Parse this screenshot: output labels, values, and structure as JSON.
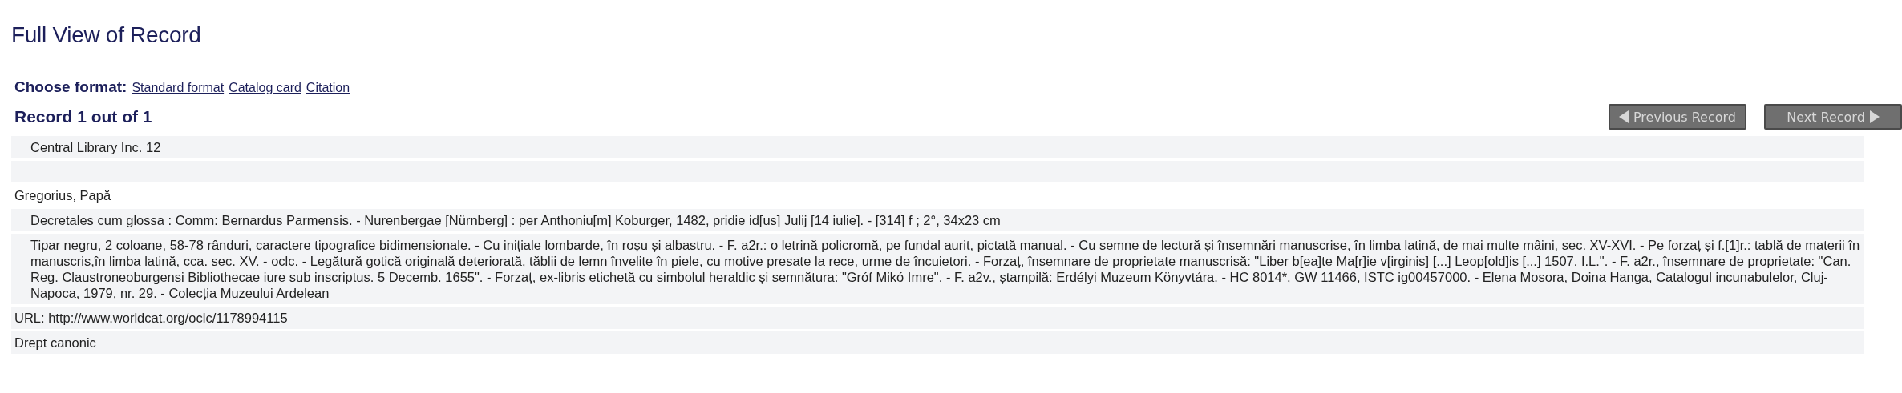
{
  "page_title": "Full View of Record",
  "format_chooser": {
    "label": "Choose format:",
    "links": [
      "Standard format",
      "Catalog card",
      "Citation"
    ]
  },
  "record_counter": "Record 1 out of 1",
  "nav_buttons": [
    {
      "label": "Previous Record",
      "kind": "previous"
    },
    {
      "label": "Next Record",
      "kind": "next"
    }
  ],
  "fields": [
    {
      "text": "Central Library Inc. 12",
      "shaded": true,
      "indented": true
    },
    {
      "shaded": true,
      "indented": false
    },
    {
      "text": "Gregorius, Papă",
      "shaded": false,
      "indented": false
    },
    {
      "text": "Decretales cum glossa : Comm: Bernardus Parmensis. - Nurenbergae [Nürnberg] : per Anthoniu[m] Koburger, 1482, pridie id[us] Julij [14 iulie]. - [314] f ; 2°, 34x23 cm",
      "shaded": true,
      "indented": true
    },
    {
      "text": "Tipar negru, 2 coloane, 58-78 rânduri, caractere tipografice bidimensionale. - Cu inițiale lombarde, în roșu și albastru. - F. a2r.: o letrină policromă, pe fundal aurit, pictată manual. - Cu semne de lectură și însemnări manuscrise, în limba latină, de mai multe mâini, sec. XV-XVI. - Pe forzaț și f.[1]r.: tablă de materii în manuscris,în limba latină, cca. sec. XV. - oclc. - Legătură gotică originală deteriorată, tăblii de lemn învelite în piele, cu motive presate la rece, urme de încuietori. - Forzaț, însemnare de proprietate manuscrisă: \"Liber b[ea]te Ma[r]ie v[irginis] [...] Leop[old]is [...] 1507. I.L.\". - F. a2r., însemnare de proprietate: \"Can. Reg. Claustroneoburgensi Bibliothecae iure sub inscriptus. 5 Decemb. 1655\". - Forzaț, ex-libris etichetă cu simbolul heraldic și semnătura: \"Gróf Mikó Imre\". - F. a2v., ștampilă: Erdélyi Muzeum Könyvtára. - HC 8014*, GW 11466, ISTC ig00457000. - Elena Mosora, Doina Hanga, Catalogul incunabulelor, Cluj-Napoca, 1979, nr. 29. - Colecția Muzeului Ardelean",
      "shaded": true,
      "indented": true
    },
    {
      "text": "URL: http://www.worldcat.org/oclc/1178994115",
      "shaded": true,
      "indented": false
    },
    {
      "text": "Drept canonic",
      "shaded": true,
      "indented": false
    }
  ]
}
